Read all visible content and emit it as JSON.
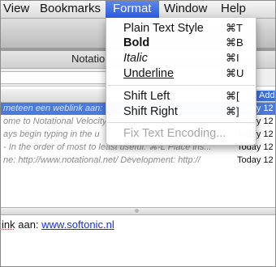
{
  "menubar": {
    "items": [
      "View",
      "Bookmarks",
      "Format",
      "Window",
      "Help"
    ],
    "active_index": 2
  },
  "window": {
    "title": "Notatio",
    "list": {
      "add_label": "Add",
      "rows": [
        {
          "text": "meteen een weblink aan:",
          "date": "Today 12"
        },
        {
          "text": "ome to Notational Velocity",
          "date": "Today 12"
        },
        {
          "text": "ays begin typing in the u",
          "date": "Today 12"
        },
        {
          "text": "- In the order of most to least useful:  ⌘-L  Place ins...",
          "date": "Today 12"
        },
        {
          "text": "ne:  http://www.notational.net/  Development:  http://",
          "date": "Today 12"
        }
      ]
    },
    "editor": {
      "prefix": "ink",
      "mid": " aan: ",
      "link": "www.softonic.nl"
    }
  },
  "format_menu": {
    "items": [
      {
        "label": "Plain Text Style",
        "shortcut": "⌘T"
      },
      {
        "label": "Bold",
        "shortcut": "⌘B"
      },
      {
        "label": "Italic",
        "shortcut": "⌘I"
      },
      {
        "label": "Underline",
        "shortcut": "⌘U"
      },
      {
        "label": "Shift Left",
        "shortcut": "⌘["
      },
      {
        "label": "Shift Right",
        "shortcut": "⌘]"
      },
      {
        "label": "Fix Text Encoding...",
        "shortcut": ""
      }
    ]
  }
}
